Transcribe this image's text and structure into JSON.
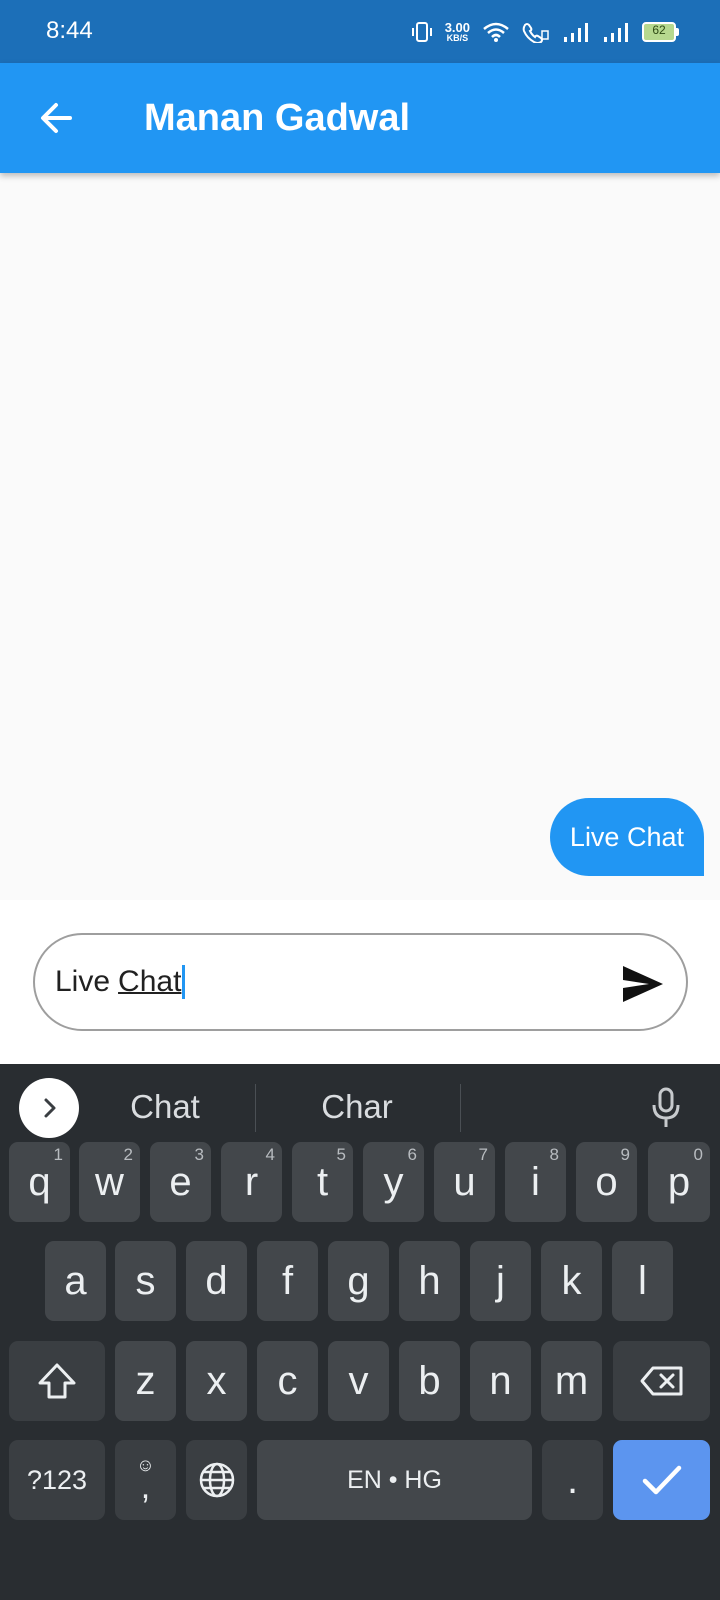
{
  "status_bar": {
    "time": "8:44",
    "net_speed_value": "3.00",
    "net_speed_unit": "KB/S",
    "battery_level": "62",
    "icons": [
      "vibrate-icon",
      "wifi-icon",
      "wifi-call-icon",
      "signal-icon",
      "signal-icon",
      "battery-icon"
    ]
  },
  "app_bar": {
    "title": "Manan Gadwal",
    "back_icon": "arrow-back-icon"
  },
  "messages": [
    {
      "text": "Live Chat",
      "sender": "me"
    }
  ],
  "composer": {
    "word_1": "Live",
    "word_2": "Chat",
    "send_icon": "send-icon"
  },
  "keyboard": {
    "suggestions": [
      "Chat",
      "Char"
    ],
    "row1": [
      {
        "key": "q",
        "hint": "1"
      },
      {
        "key": "w",
        "hint": "2"
      },
      {
        "key": "e",
        "hint": "3"
      },
      {
        "key": "r",
        "hint": "4"
      },
      {
        "key": "t",
        "hint": "5"
      },
      {
        "key": "y",
        "hint": "6"
      },
      {
        "key": "u",
        "hint": "7"
      },
      {
        "key": "i",
        "hint": "8"
      },
      {
        "key": "o",
        "hint": "9"
      },
      {
        "key": "p",
        "hint": "0"
      }
    ],
    "row2": [
      "a",
      "s",
      "d",
      "f",
      "g",
      "h",
      "j",
      "k",
      "l"
    ],
    "row3": [
      "z",
      "x",
      "c",
      "v",
      "b",
      "n",
      "m"
    ],
    "symbols_key": "?123",
    "comma_key": ",",
    "emoji_hint": "☺",
    "space_label": "EN • HG",
    "period_key": ".",
    "colors": {
      "enter": "#5c95ef",
      "key": "#43474b",
      "background": "#292d31"
    }
  },
  "colors": {
    "primary": "#2196f3",
    "status_bar": "#1c6fb8"
  }
}
